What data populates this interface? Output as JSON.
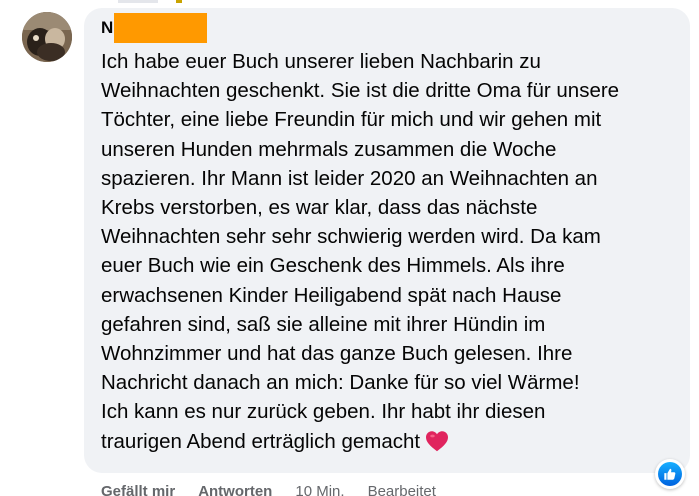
{
  "comment": {
    "author_initial": "N",
    "lines": [
      "Ich habe euer Buch unserer lieben Nachbarin zu",
      "Weihnachten geschenkt. Sie ist die dritte Oma für unsere",
      "Töchter, eine liebe Freundin für mich und wir gehen mit",
      "unseren Hunden mehrmals zusammen die Woche",
      "spazieren. Ihr Mann ist leider 2020 an Weihnachten an",
      "Krebs verstorben, es war klar, dass das nächste",
      "Weihnachten sehr sehr schwierig werden wird. Da kam",
      "euer Buch wie ein Geschenk des Himmels. Als ihre",
      "erwachsenen Kinder Heiligabend spät nach Hause",
      "gefahren sind, saß sie alleine mit ihrer Hündin im",
      "Wohnzimmer und hat das ganze Buch gelesen. Ihre",
      "Nachricht danach an mich: Danke für so viel Wärme!",
      "Ich kann es nur zurück geben. Ihr habt ihr diesen",
      "traurigen Abend erträglich gemacht"
    ],
    "emoji": "heart-icon",
    "reaction": "like-icon"
  },
  "actions": {
    "like_label": "Gefällt mir",
    "reply_label": "Antworten",
    "time_label": "10 Min.",
    "edited_label": "Bearbeitet"
  },
  "colors": {
    "bubble": "#f0f2f5",
    "text": "#050505",
    "secondary": "#65676b",
    "redaction": "#ff9900",
    "heart": "#e0245e",
    "like_blue": "#0866ff"
  }
}
